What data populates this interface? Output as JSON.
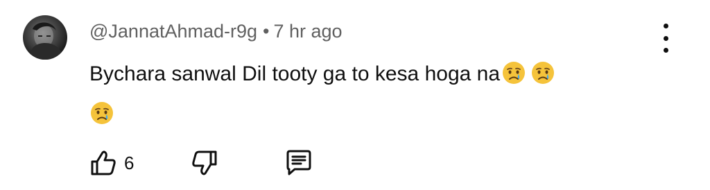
{
  "comment": {
    "author": "@JannatAhmad-r9g",
    "separator": "•",
    "time": "7 hr ago",
    "text": "Bychara sanwal Dil tooty ga to kesa hoga na",
    "emojis": [
      "crying-face-emoji",
      "crying-face-emoji",
      "crying-face-emoji"
    ],
    "like_count": "6"
  },
  "icons": {
    "avatar": "avatar",
    "like": "thumbs-up-icon",
    "dislike": "thumbs-down-icon",
    "reply": "comment-reply-icon",
    "menu": "more-vertical-icon"
  },
  "colors": {
    "text": "#0f0f0f",
    "meta": "#606060",
    "emoji_face": "#F5C33B",
    "emoji_tear": "#3FA9F5"
  }
}
